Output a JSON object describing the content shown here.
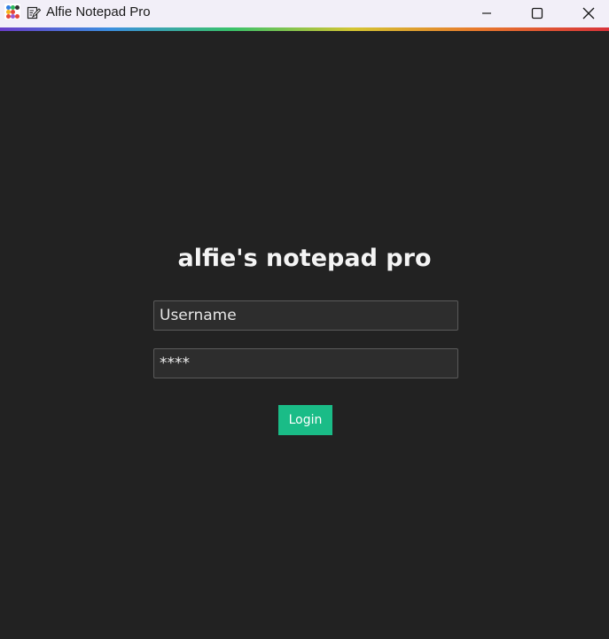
{
  "window": {
    "title": "Alfie Notepad Pro",
    "app_icon": "app-launcher-icon",
    "notepad_icon": "notepad-icon",
    "controls": {
      "minimize_icon": "minimize-icon",
      "maximize_icon": "maximize-icon",
      "close_icon": "close-icon"
    }
  },
  "login": {
    "heading": "alfie's notepad pro",
    "username": {
      "value": "",
      "placeholder": "Username"
    },
    "password": {
      "value": "****",
      "placeholder": ""
    },
    "button_label": "Login"
  },
  "colors": {
    "background": "#222222",
    "titlebar": "#f2eff8",
    "field_background": "#2d2d2d",
    "button": "#1abc87",
    "text": "#f4f4f4"
  }
}
